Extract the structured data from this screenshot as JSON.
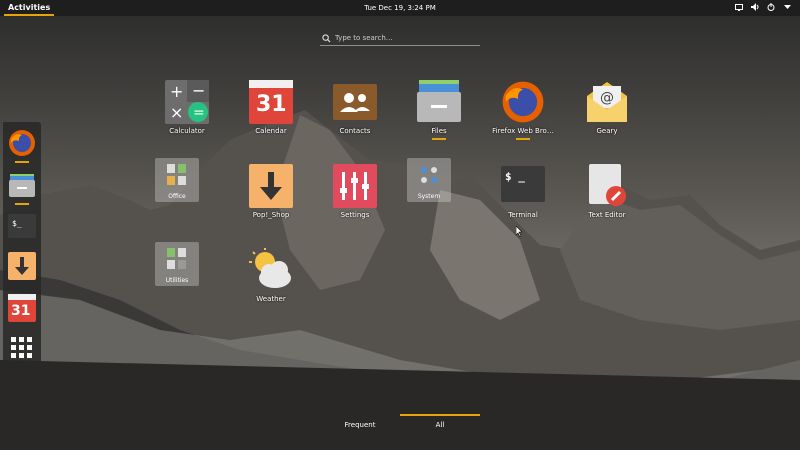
{
  "topbar": {
    "activities_label": "Activities",
    "clock": "Tue Dec 19,  3:24 PM",
    "tray": {
      "screen_icon": "screen-icon",
      "volume_icon": "volume-icon",
      "power_icon": "power-icon",
      "menu_icon": "chevron-down-icon"
    }
  },
  "search": {
    "placeholder": "Type to search…"
  },
  "dock": {
    "items": [
      {
        "name": "Firefox",
        "icon": "firefox-icon",
        "running": true
      },
      {
        "name": "Files",
        "icon": "files-icon",
        "running": true
      },
      {
        "name": "Terminal",
        "icon": "terminal-icon",
        "running": false
      },
      {
        "name": "Pop!_Shop",
        "icon": "shop-icon",
        "running": false
      },
      {
        "name": "Calendar",
        "icon": "calendar-icon",
        "running": false
      },
      {
        "name": "Show Applications",
        "icon": "app-grid-icon",
        "running": false
      }
    ]
  },
  "apps": [
    {
      "label": "Calculator",
      "icon": "calculator-icon",
      "running": false
    },
    {
      "label": "Calendar",
      "icon": "calendar-icon",
      "running": false,
      "calendar_day": "31"
    },
    {
      "label": "Contacts",
      "icon": "contacts-icon",
      "running": false
    },
    {
      "label": "Files",
      "icon": "files-icon",
      "running": true
    },
    {
      "label": "Firefox Web Bro…",
      "icon": "firefox-icon",
      "running": true
    },
    {
      "label": "Geary",
      "icon": "mail-icon",
      "running": false
    },
    {
      "label": "Office",
      "icon": "folder-icon",
      "running": false
    },
    {
      "label": "Pop!_Shop",
      "icon": "shop-icon",
      "running": false
    },
    {
      "label": "Settings",
      "icon": "settings-icon",
      "running": false
    },
    {
      "label": "System",
      "icon": "folder-icon",
      "running": false
    },
    {
      "label": "Terminal",
      "icon": "terminal-icon",
      "running": false,
      "prompt": "$ _"
    },
    {
      "label": "Text Editor",
      "icon": "text-editor-icon",
      "running": false
    },
    {
      "label": "Utilities",
      "icon": "folder-icon",
      "running": false
    },
    {
      "label": "Weather",
      "icon": "weather-icon",
      "running": false
    }
  ],
  "dock_labels": {
    "terminal_prompt": "$_",
    "calendar_day": "31"
  },
  "bottom_tabs": [
    {
      "label": "Frequent",
      "active": false
    },
    {
      "label": "All",
      "active": true
    }
  ],
  "colors": {
    "accent": "#e5a50a",
    "topbar": "#1e1e1e"
  }
}
